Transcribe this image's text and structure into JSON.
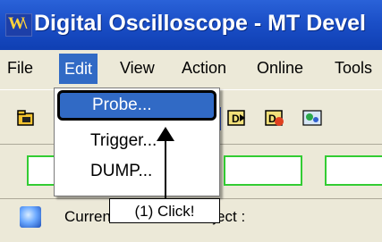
{
  "window": {
    "app_icon_text": "W\\",
    "title": "Digital Oscilloscope - MT Devel"
  },
  "menu": {
    "items": [
      {
        "label": "File"
      },
      {
        "label": "Edit",
        "active": true
      },
      {
        "label": "View"
      },
      {
        "label": "Action"
      },
      {
        "label": "Online"
      },
      {
        "label": "Tools"
      }
    ]
  },
  "edit_menu": {
    "items": [
      {
        "label": "Probe...",
        "highlighted": true
      },
      {
        "label": "Trigger..."
      },
      {
        "label": "DUMP..."
      }
    ]
  },
  "toolbar": {
    "icons": [
      "open-folder-icon",
      "probe-icon",
      "run-icon",
      "run-hand-icon",
      "connect-icon"
    ]
  },
  "fields": {
    "count": 3,
    "border_color": "#33cc33"
  },
  "status": {
    "text": "Current Comment Project :"
  },
  "callout": {
    "text": "(1) Click!"
  },
  "colors": {
    "title_bar": "#1b4fc7",
    "menu_highlight": "#316ac5",
    "background": "#ece9d8"
  }
}
